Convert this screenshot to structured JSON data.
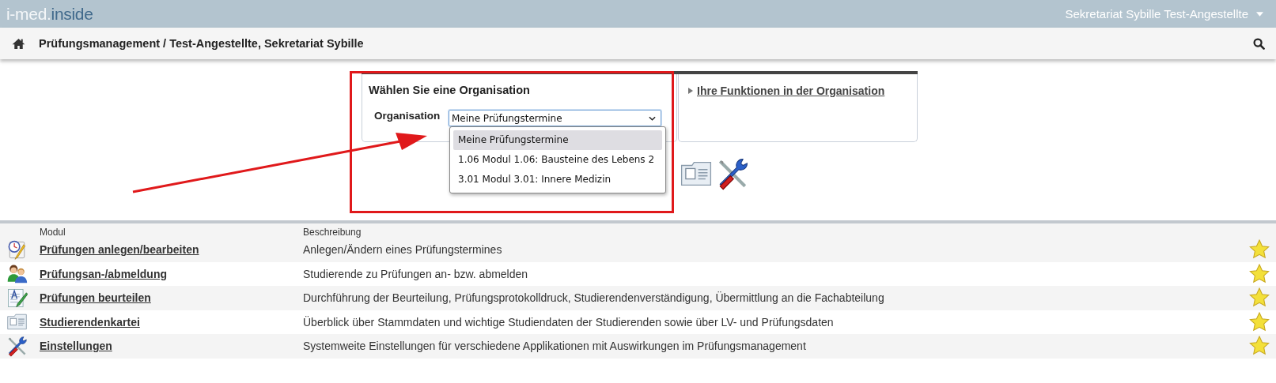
{
  "header": {
    "logo": {
      "prefix": "i-med.",
      "name": "inside"
    },
    "user_menu": "Sekretariat Sybille Test-Angestellte"
  },
  "breadcrumb": "Prüfungsmanagement / Test-Angestellte, Sekretariat Sybille",
  "org_panel": {
    "title": "Wählen Sie eine Organisation",
    "field_label": "Organisation",
    "select_value": "Meine Prüfungstermine",
    "expanded": true,
    "options": [
      {
        "label": "Meine Prüfungstermine",
        "selected": true
      },
      {
        "label": "1.06 Modul 1.06: Bausteine des Lebens 2",
        "selected": false
      },
      {
        "label": "3.01 Modul 3.01: Innere Medizin",
        "selected": false
      }
    ]
  },
  "functions_link": "Ihre Funktionen in der Organisation",
  "shortcut_icons": [
    {
      "kind": "card"
    },
    {
      "kind": "tools"
    }
  ],
  "table": {
    "columns": [
      "Modul",
      "Beschreibung"
    ],
    "rows": [
      {
        "kind": "schedule",
        "module": "Prüfungen anlegen/bearbeiten",
        "description": "Anlegen/Ändern eines Prüfungstermines",
        "favorite": true
      },
      {
        "kind": "people",
        "module": "Prüfungsan-/abmeldung",
        "description": "Studierende zu Prüfungen an- bzw. abmelden",
        "favorite": true
      },
      {
        "kind": "grading",
        "module": "Prüfungen beurteilen",
        "description": "Durchführung der Beurteilung, Prüfungsprotokolldruck, Studierendenverständigung, Übermittlung an die Fachabteilung",
        "favorite": true
      },
      {
        "kind": "card",
        "module": "Studierendenkartei",
        "description": "Überblick über Stammdaten und wichtige Studiendaten der Studierenden sowie über LV- und Prüfungsdaten",
        "favorite": true
      },
      {
        "kind": "tools",
        "module": "Einstellungen",
        "description": "Systemweite Einstellungen für verschiedene Applikationen mit Auswirkungen im Prüfungsmanagement",
        "favorite": true
      }
    ]
  }
}
